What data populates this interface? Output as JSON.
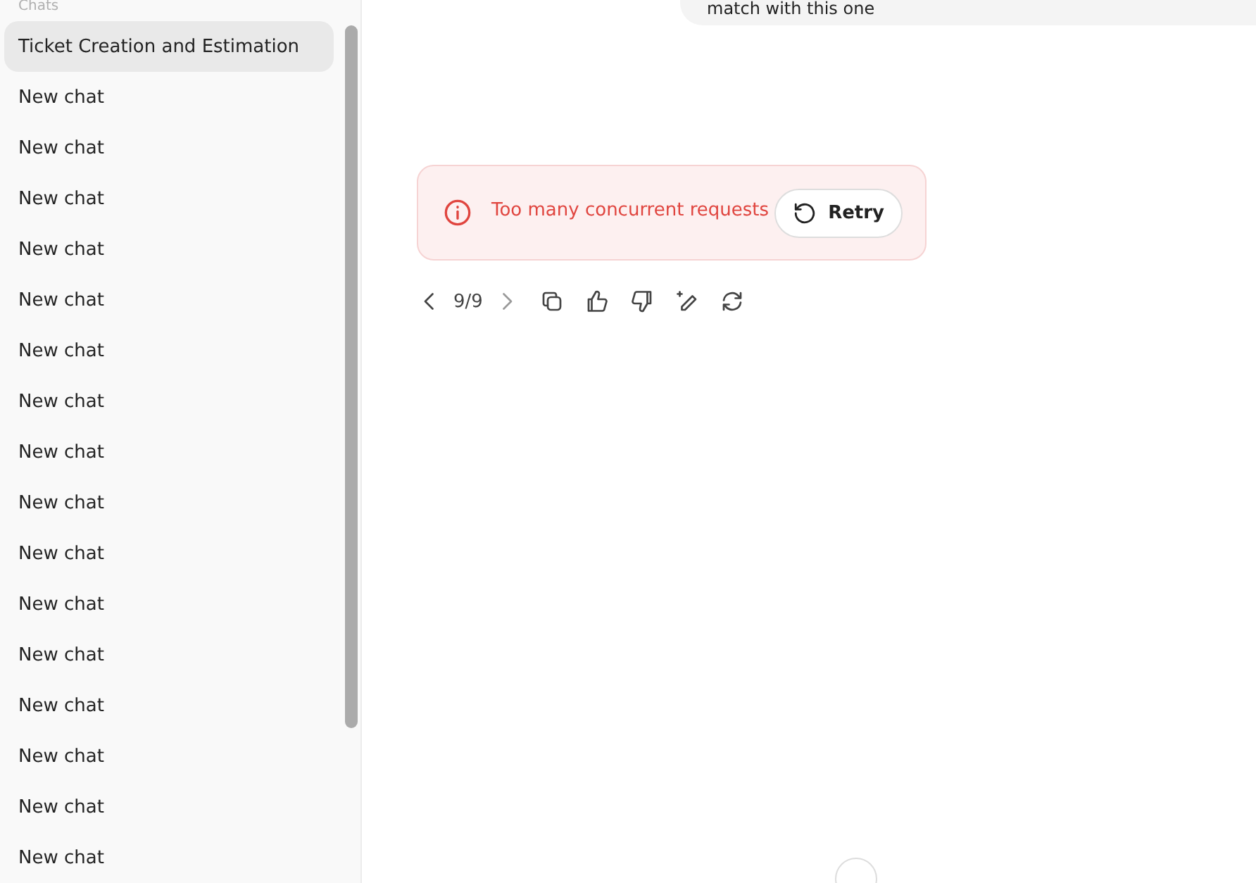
{
  "sidebar": {
    "header": "Chats",
    "items": [
      {
        "label": "Ticket Creation and Estimation",
        "selected": true
      },
      {
        "label": "New chat",
        "selected": false
      },
      {
        "label": "New chat",
        "selected": false
      },
      {
        "label": "New chat",
        "selected": false
      },
      {
        "label": "New chat",
        "selected": false
      },
      {
        "label": "New chat",
        "selected": false
      },
      {
        "label": "New chat",
        "selected": false
      },
      {
        "label": "New chat",
        "selected": false
      },
      {
        "label": "New chat",
        "selected": false
      },
      {
        "label": "New chat",
        "selected": false
      },
      {
        "label": "New chat",
        "selected": false
      },
      {
        "label": "New chat",
        "selected": false
      },
      {
        "label": "New chat",
        "selected": false
      },
      {
        "label": "New chat",
        "selected": false
      },
      {
        "label": "New chat",
        "selected": false
      },
      {
        "label": "New chat",
        "selected": false
      },
      {
        "label": "New chat",
        "selected": false
      }
    ]
  },
  "user_message": "match with this one",
  "error": {
    "message": "Too many concurrent requests",
    "button": "Retry"
  },
  "response_nav": {
    "counter": "9/9"
  }
}
